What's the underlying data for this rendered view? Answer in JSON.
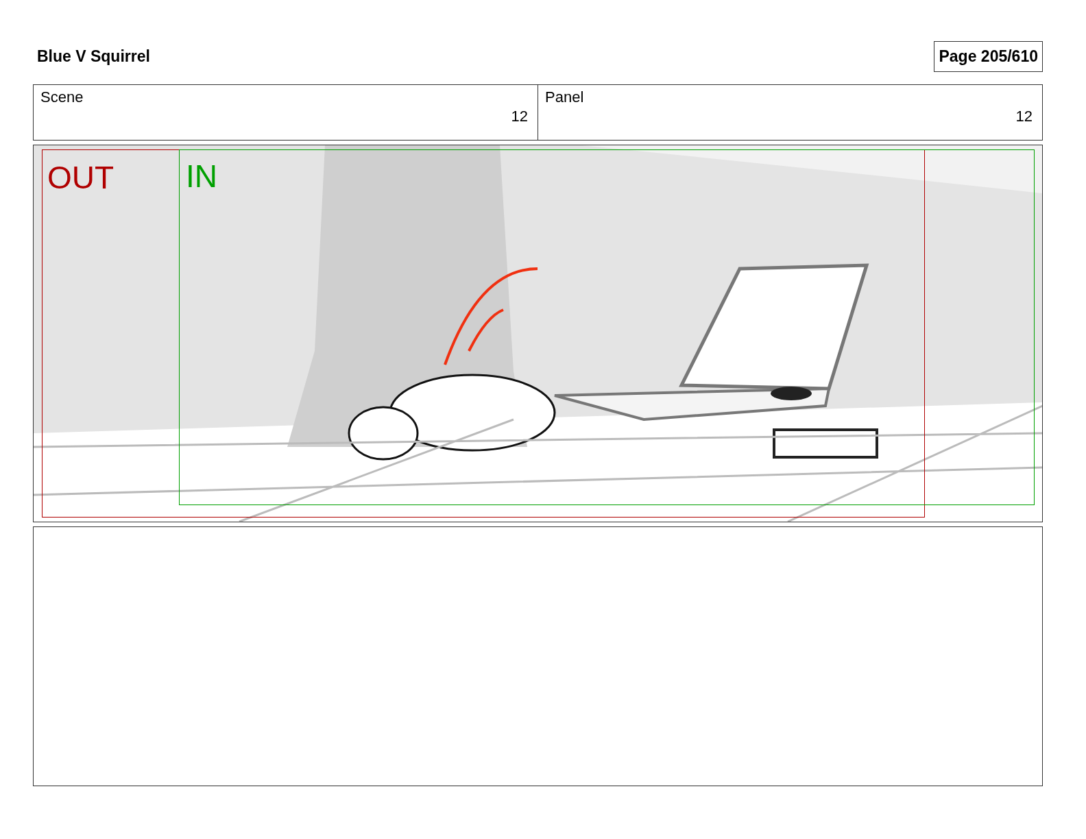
{
  "header": {
    "title": "Blue V Squirrel",
    "page": "Page 205/610"
  },
  "info": [
    {
      "label": "Scene",
      "value": "12"
    },
    {
      "label": "Panel",
      "value": "12"
    }
  ],
  "panel": {
    "kind": "sketch",
    "frames": [
      {
        "label": "OUT",
        "color": "#b00000"
      },
      {
        "label": "IN",
        "color": "#00a000"
      }
    ]
  }
}
